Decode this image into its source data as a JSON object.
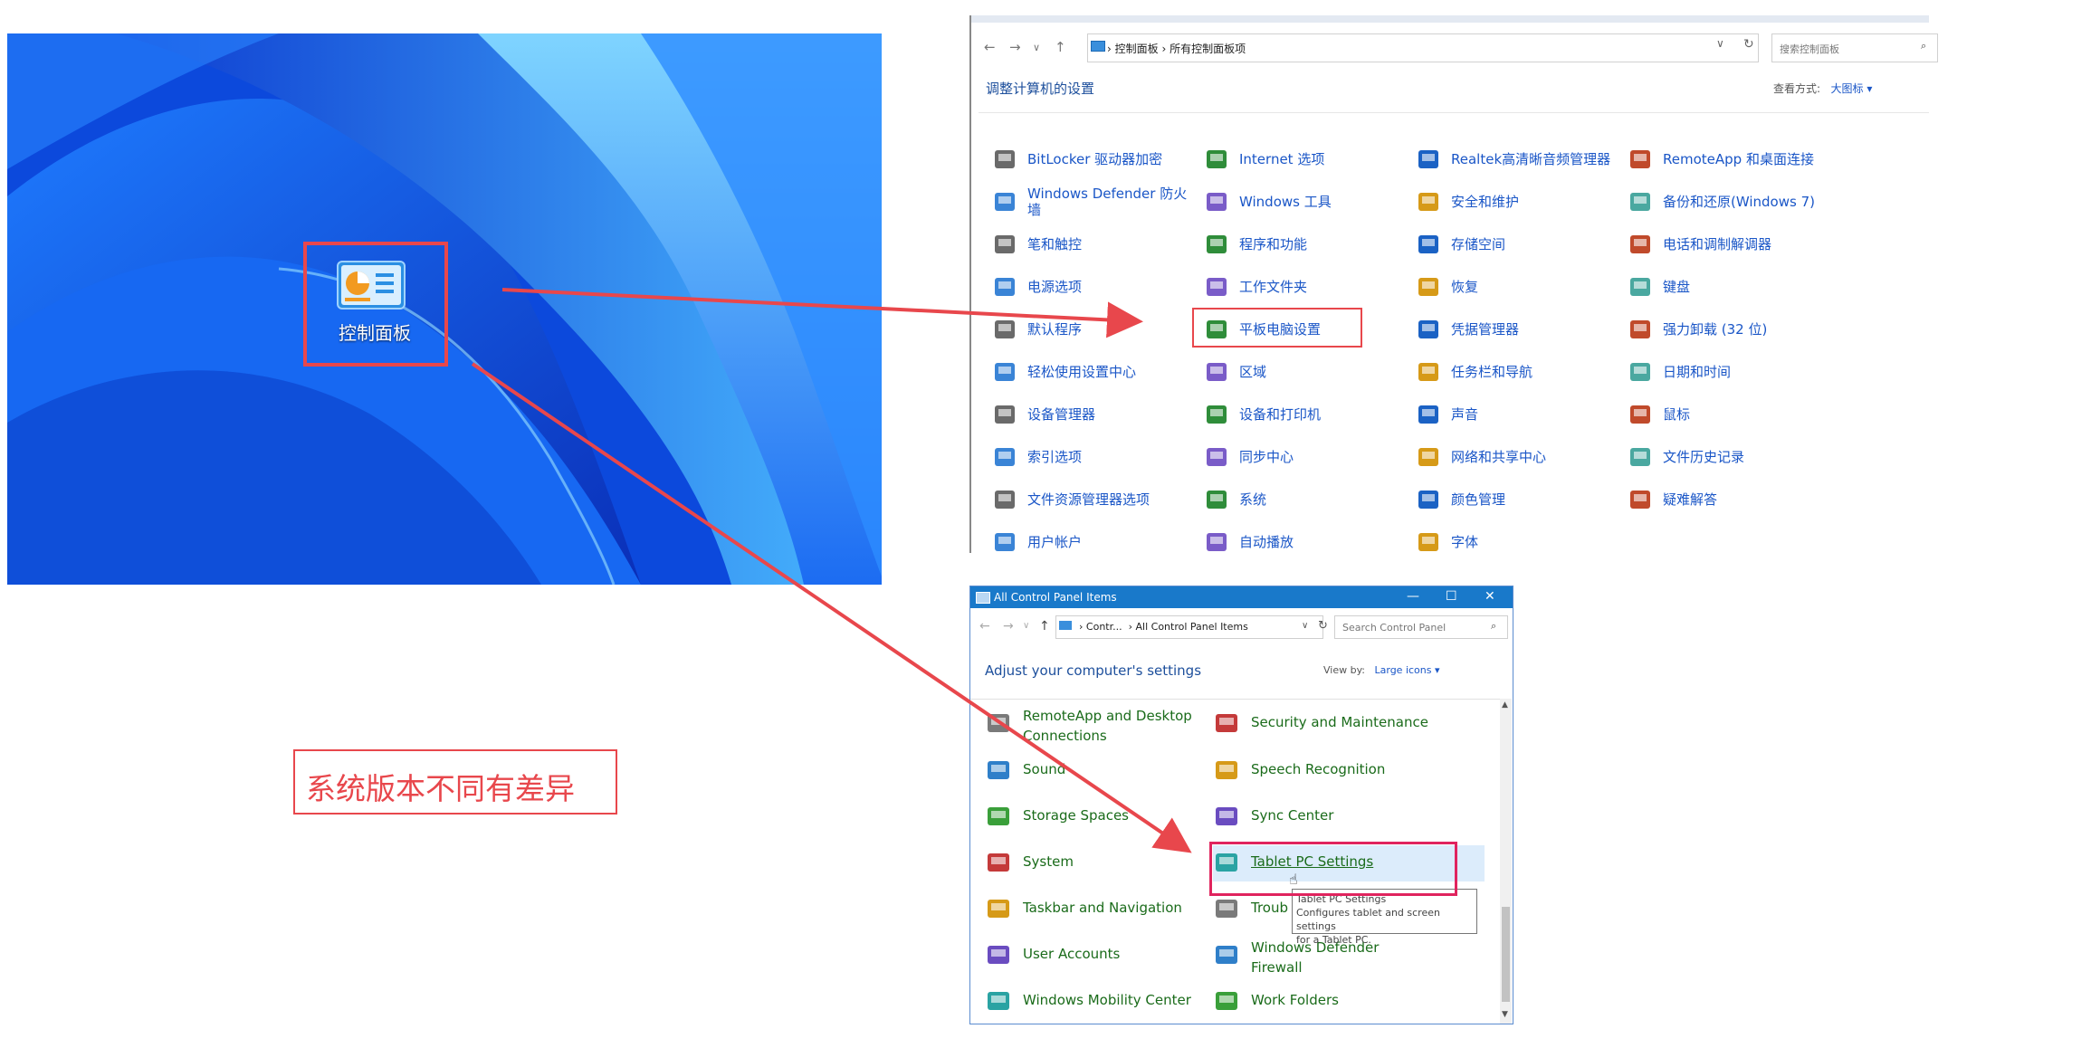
{
  "desktop": {
    "icon_label": "控制面板"
  },
  "cn_panel": {
    "breadcrumb": [
      "控制面板",
      "所有控制面板项"
    ],
    "search_placeholder": "搜索控制面板",
    "header": "调整计算机的设置",
    "view_label": "查看方式:",
    "view_value": "大图标 ▾",
    "items": [
      "BitLocker 驱动器加密",
      "Internet 选项",
      "Realtek高清晰音频管理器",
      "RemoteApp 和桌面连接",
      "Windows Defender 防火墙",
      "Windows 工具",
      "安全和维护",
      "备份和还原(Windows 7)",
      "笔和触控",
      "程序和功能",
      "存储空间",
      "电话和调制解调器",
      "电源选项",
      "工作文件夹",
      "恢复",
      "键盘",
      "默认程序",
      "平板电脑设置",
      "凭据管理器",
      "强力卸载 (32 位)",
      "轻松使用设置中心",
      "区域",
      "任务栏和导航",
      "日期和时间",
      "设备管理器",
      "设备和打印机",
      "声音",
      "鼠标",
      "索引选项",
      "同步中心",
      "网络和共享中心",
      "文件历史记录",
      "文件资源管理器选项",
      "系统",
      "颜色管理",
      "疑难解答",
      "用户帐户",
      "自动播放",
      "字体"
    ]
  },
  "en_panel": {
    "title": "All Control Panel Items",
    "breadcrumb": [
      "Contr...",
      "All Control Panel Items"
    ],
    "search_placeholder": "Search Control Panel",
    "header": "Adjust your computer's settings",
    "view_label": "View by:",
    "view_value": "Large icons ▾",
    "items_left": [
      "RemoteApp and Desktop Connections",
      "Sound",
      "Storage Spaces",
      "System",
      "Taskbar and Navigation",
      "User Accounts",
      "Windows Mobility Center"
    ],
    "items_right": [
      "Security and Maintenance",
      "Speech Recognition",
      "Sync Center",
      "Tablet PC Settings",
      "Troub",
      "Windows Defender Firewall",
      "Work Folders"
    ],
    "tooltip": [
      "Tablet PC Settings",
      "Configures tablet and screen settings",
      "for a Tablet PC."
    ]
  },
  "note": "系统版本不同有差异",
  "colors": {
    "annotation": "#e8474c",
    "link_blue": "#1a56c7",
    "link_green": "#1a6b1a",
    "titlebar": "#1979ca"
  }
}
